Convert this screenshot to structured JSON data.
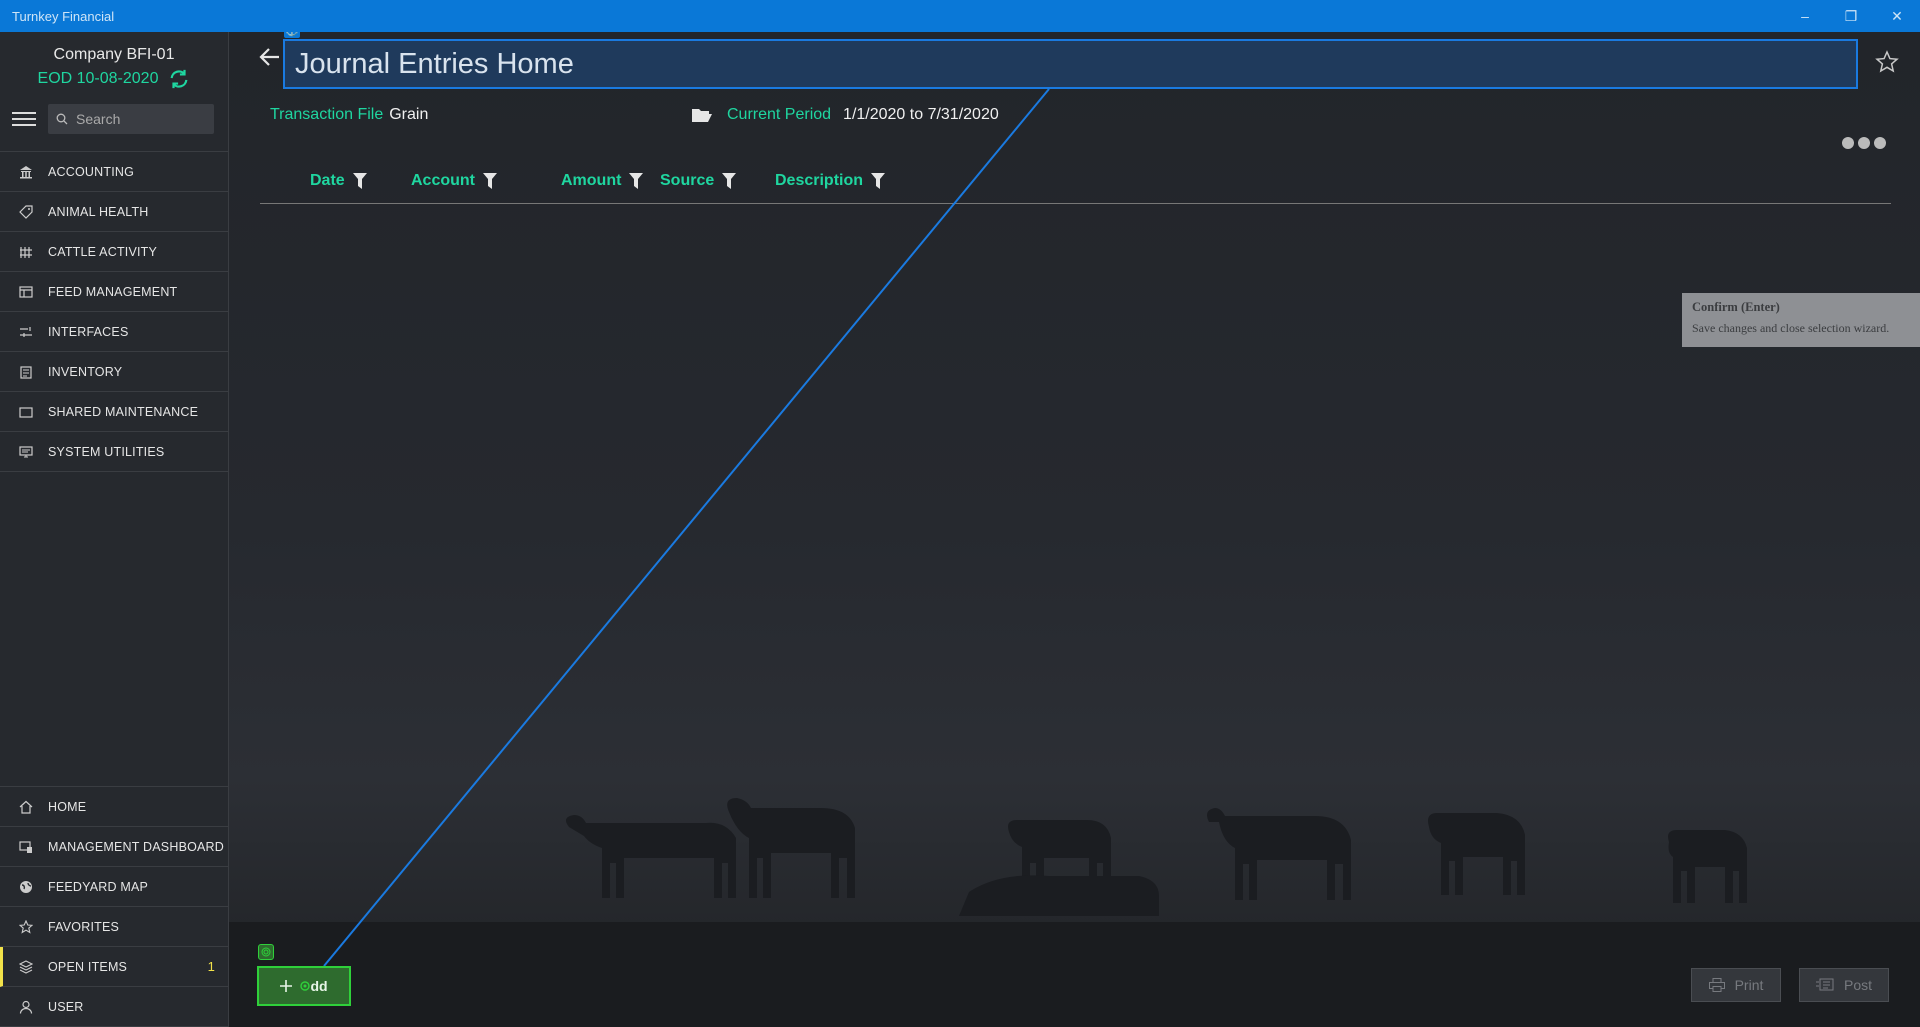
{
  "window": {
    "title": "Turnkey Financial",
    "minimize": "–",
    "restore": "❐",
    "close": "✕"
  },
  "sidebar": {
    "company": "Company BFI-01",
    "eod": "EOD 10-08-2020",
    "search_placeholder": "Search",
    "items": [
      {
        "label": "ACCOUNTING",
        "icon": "bank-icon"
      },
      {
        "label": "ANIMAL HEALTH",
        "icon": "tag-icon"
      },
      {
        "label": "CATTLE ACTIVITY",
        "icon": "fence-icon"
      },
      {
        "label": "FEED MANAGEMENT",
        "icon": "feed-icon"
      },
      {
        "label": "INTERFACES",
        "icon": "interfaces-icon"
      },
      {
        "label": "INVENTORY",
        "icon": "clipboard-icon"
      },
      {
        "label": "SHARED MAINTENANCE",
        "icon": "folder-icon"
      },
      {
        "label": "SYSTEM UTILITIES",
        "icon": "monitor-icon"
      }
    ],
    "bottom_items": [
      {
        "label": "HOME",
        "icon": "home-icon"
      },
      {
        "label": "MANAGEMENT DASHBOARD",
        "icon": "dashboard-icon"
      },
      {
        "label": "FEEDYARD MAP",
        "icon": "globe-icon"
      },
      {
        "label": "FAVORITES",
        "icon": "star-icon"
      },
      {
        "label": "OPEN ITEMS",
        "icon": "layers-icon",
        "count": "1"
      },
      {
        "label": "USER",
        "icon": "user-icon"
      }
    ]
  },
  "main": {
    "page_title": "Journal Entries Home",
    "transaction_file_label": "Transaction File",
    "transaction_file_value": "Grain",
    "current_period_label": "Current Period",
    "current_period_value": "1/1/2020 to 7/31/2020",
    "columns": [
      "Date",
      "Account",
      "Amount",
      "Source",
      "Description"
    ],
    "tooltip": {
      "title": "Confirm (Enter)",
      "description": "Save changes and close selection wizard."
    },
    "add_label": "dd",
    "print_label": "Print",
    "post_label": "Post"
  },
  "colors": {
    "accent": "#1fd6a0",
    "titlebar": "#0a78d7",
    "add_green": "#2fd03a",
    "open_items": "#f2e24a"
  }
}
